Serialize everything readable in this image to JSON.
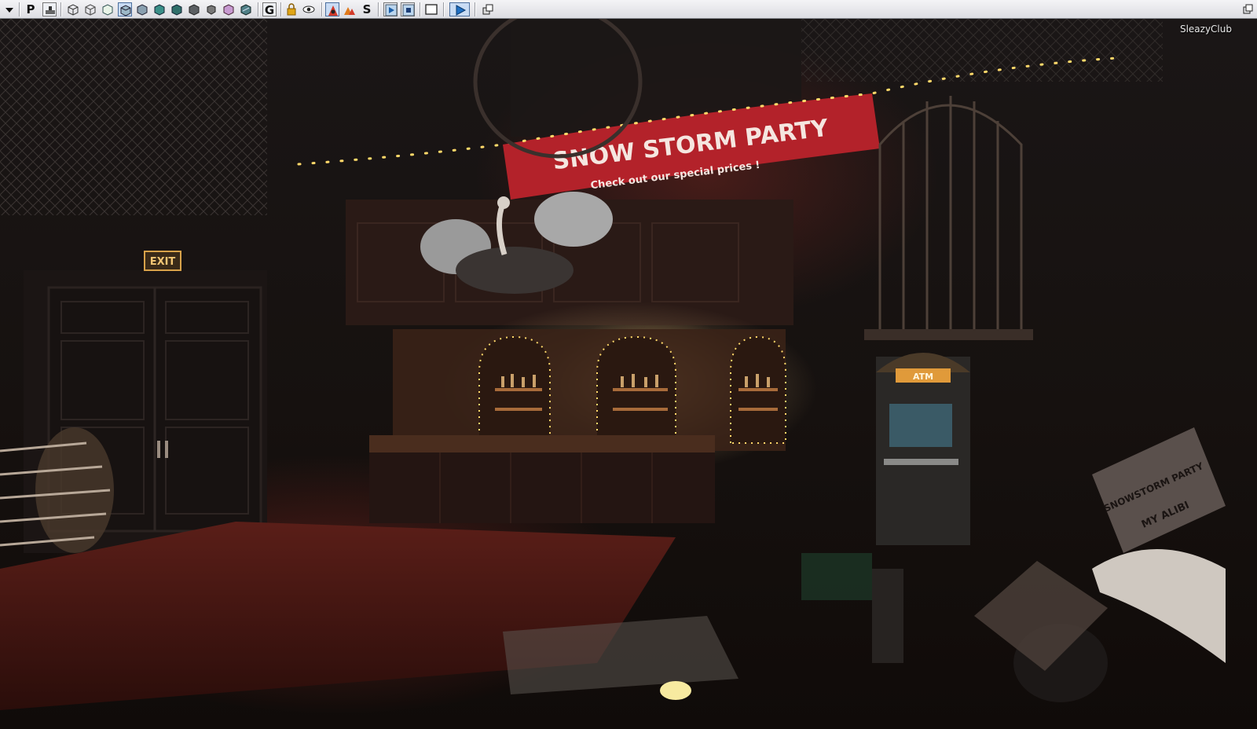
{
  "toolbar": {
    "dropdown_icon": "triangle-down-icon",
    "buttons": [
      {
        "name": "perspective-button",
        "label": "P"
      },
      {
        "name": "game-view-icon"
      },
      {
        "name": "wireframe-view-icon"
      },
      {
        "name": "brush-wireframe-icon"
      },
      {
        "name": "unlit-view-icon"
      },
      {
        "name": "lit-view-icon"
      },
      {
        "name": "detail-lighting-icon"
      },
      {
        "name": "lighting-only-icon"
      },
      {
        "name": "light-complexity-icon"
      },
      {
        "name": "texture-density-icon"
      },
      {
        "name": "shader-complexity-icon"
      },
      {
        "name": "lightmap-density-icon"
      },
      {
        "name": "reflections-icon"
      },
      {
        "name": "game-mode-button",
        "label": "G"
      },
      {
        "name": "lock-icon"
      },
      {
        "name": "eye-icon"
      },
      {
        "name": "realtime-icon"
      },
      {
        "name": "streaming-icon"
      },
      {
        "name": "streaming-button",
        "label": "S"
      },
      {
        "name": "play-in-viewport-icon"
      },
      {
        "name": "stop-icon"
      },
      {
        "name": "maximize-viewport-icon"
      },
      {
        "name": "play-icon"
      },
      {
        "name": "camera-speed-icon"
      }
    ]
  },
  "viewport": {
    "level_name": "SleazyClub",
    "scene": {
      "banner_title": "SNOW STORM PARTY",
      "banner_subtitle": "Check out our special prices !",
      "exit_sign": "EXIT",
      "atm_sign": "ATM",
      "poster_title": "SNOWSTORM PARTY",
      "poster_subtitle": "MY ALIBI"
    }
  },
  "colors": {
    "toolbar_bg": "#e6e7eb",
    "banner_red": "#b3222a",
    "string_light": "#ffd96a",
    "exit_sign": "#d8a24a"
  }
}
